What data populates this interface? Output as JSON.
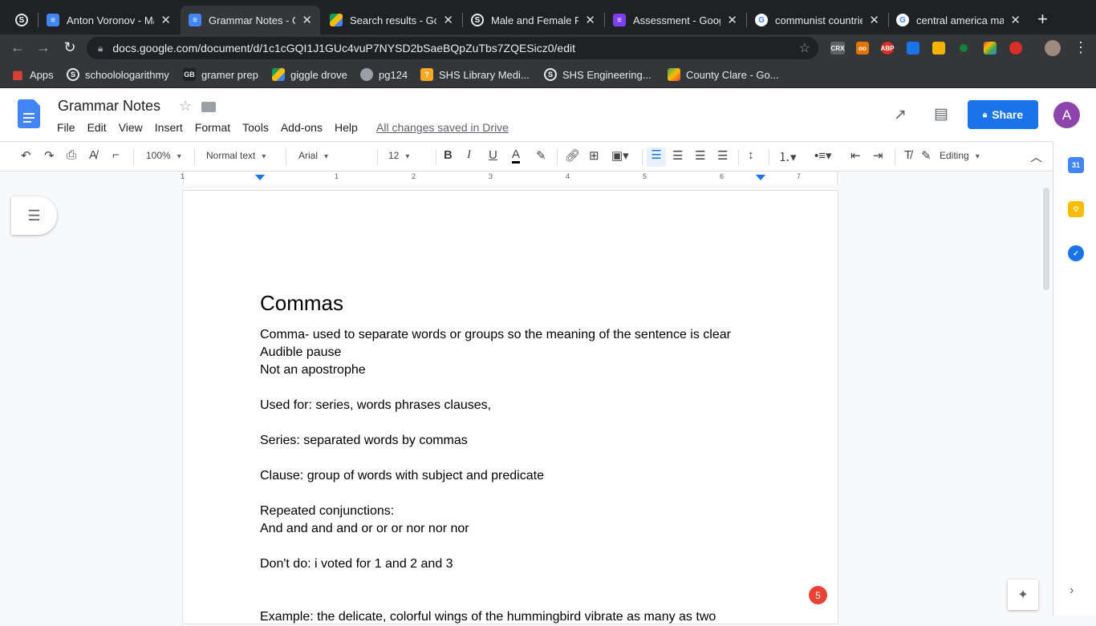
{
  "tabs": [
    {
      "title": "",
      "icon": "schoology-icon",
      "color": "#5f6368"
    },
    {
      "title": "Anton Voronov - Ma",
      "icon": "docs-icon",
      "color": "#4285f4"
    },
    {
      "title": "Grammar Notes - G",
      "icon": "docs-icon",
      "color": "#4285f4"
    },
    {
      "title": "Search results - Go",
      "icon": "drive-icon",
      "color": "#fbbc04"
    },
    {
      "title": "Male and Female Re",
      "icon": "schoology-icon",
      "color": "#5f6368"
    },
    {
      "title": "Assessment - Goog",
      "icon": "forms-icon",
      "color": "#7e3ff2"
    },
    {
      "title": "communist countrie",
      "icon": "google-icon",
      "color": "#ffffff"
    },
    {
      "title": "central america map",
      "icon": "google-icon",
      "color": "#ffffff"
    }
  ],
  "new_tab": "+",
  "address": {
    "url": "docs.google.com/document/d/1c1cGQI1J1GUc4vuP7NYSD2bSaeBQpZuTbs7ZQESicz0/edit"
  },
  "extensions": [
    {
      "label": "CRX",
      "color": "#5f6368"
    },
    {
      "label": "oo",
      "color": "#e37400"
    },
    {
      "label": "ABP",
      "color": "#d93025"
    },
    {
      "label": "",
      "color": "#1a73e8"
    },
    {
      "label": "",
      "color": "#f4b400"
    },
    {
      "label": "",
      "color": "#188038"
    },
    {
      "label": "",
      "color": "#a142f4"
    },
    {
      "label": "",
      "color": "#d93025"
    }
  ],
  "bookmarks": [
    {
      "label": "Apps",
      "color": "#ea4335"
    },
    {
      "label": "schoolologarithmy",
      "color": "#5f6368"
    },
    {
      "label": "gramer prep",
      "color": "#202124"
    },
    {
      "label": "giggle drove",
      "color": "#fbbc04"
    },
    {
      "label": "pg124",
      "color": "#5f6368"
    },
    {
      "label": "SHS Library Medi...",
      "color": "#f9a825"
    },
    {
      "label": "SHS Engineering...",
      "color": "#5f6368"
    },
    {
      "label": "County Clare - Go...",
      "color": "#ea4335"
    }
  ],
  "doc": {
    "title": "Grammar Notes",
    "menus": [
      "File",
      "Edit",
      "View",
      "Insert",
      "Format",
      "Tools",
      "Add-ons",
      "Help"
    ],
    "saved_status": "All changes saved in Drive",
    "share_label": "Share",
    "avatar_letter": "A"
  },
  "toolbar": {
    "zoom": "100%",
    "style": "Normal text",
    "font": "Arial",
    "size": "12",
    "mode": "Editing"
  },
  "ruler": [
    "1",
    "1",
    "2",
    "3",
    "4",
    "5",
    "6",
    "7"
  ],
  "content": {
    "heading": "Commas",
    "lines": [
      "Comma- used to separate words or groups so the meaning of the sentence is clear",
      "Audible pause",
      "Not an apostrophe",
      "",
      "Used for: series, words phrases clauses,",
      "",
      "Series: separated words by commas",
      "",
      "Clause: group of words with subject and predicate",
      "",
      "Repeated conjunctions:",
      "And and and and or or or nor nor nor",
      "",
      "Don't do: i voted for 1 and 2 and 3",
      "",
      "",
      "Example: the delicate, colorful wings of the hummingbird vibrate as many as two"
    ]
  },
  "comment_badge": "5"
}
